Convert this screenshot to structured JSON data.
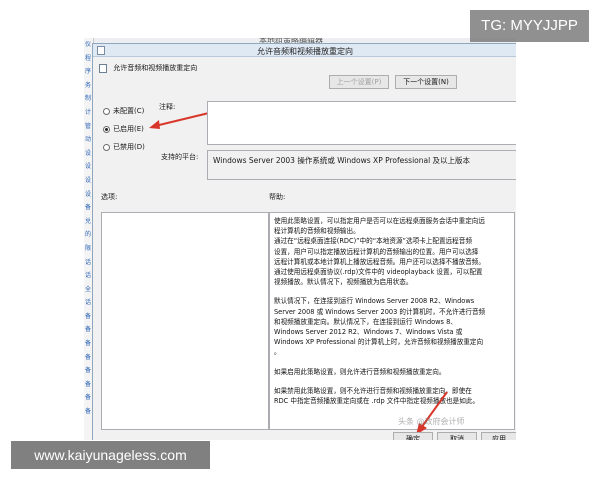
{
  "background_window": {
    "title": "本地组策略编辑器",
    "left_strip": [
      "仪",
      "程",
      "序",
      "务",
      "制",
      "计",
      "管",
      "动",
      "设",
      "设",
      "设",
      "设",
      "备",
      "兑",
      "的",
      "限",
      "话",
      "话",
      "全",
      "话",
      "备",
      "备",
      "备",
      "备",
      "备",
      "备",
      "备",
      "备"
    ]
  },
  "dialog": {
    "title": "允许音频和视频播放重定向",
    "policy_name": "允许音频和视频播放重定向",
    "prev_button": "上一个设置(P)",
    "next_button": "下一个设置(N)",
    "radios": [
      {
        "label": "未配置(C)",
        "checked": false
      },
      {
        "label": "已启用(E)",
        "checked": true
      },
      {
        "label": "已禁用(D)",
        "checked": false
      }
    ],
    "comment_label": "注释:",
    "platform_label": "支持的平台:",
    "platform_value": "Windows Server 2003 操作系统或 Windows XP Professional 及以上版本",
    "options_label": "选项:",
    "help_label": "帮助:",
    "help_paragraphs": [
      "使用此策略设置，可以指定用户是否可以在远程桌面服务会话中重定向远\n程计算机的音频和视频输出。\n通过在“远程桌面连接(RDC)”中的“本地资源”选项卡上配置远程音频\n设置，用户可以指定播放远程计算机的音频输出的位置。用户可以选择\n远程计算机或本地计算机上播放远程音频。用户还可以选择不播放音频。\n通过使用远程桌面协议(.rdp)文件中的 videoplayback 设置，可以配置\n视频播放。默认情况下，视频播放为启用状态。",
      "默认情况下，在连接到运行 Windows Server 2008 R2、Windows\nServer 2008 或 Windows Server 2003 的计算机时，不允许进行音频\n和视频播放重定向。默认情况下，在连接到运行 Windows 8、\nWindows Server 2012 R2、Windows 7、Windows Vista 或\nWindows XP Professional 的计算机上时，允许音频和视频播放重定向\n。",
      "如果启用此策略设置，则允许进行音频和视频播放重定向。",
      "如果禁用此策略设置，则不允许进行音频和视频播放重定向，即使在\nRDC 中指定音频播放重定向或在 .rdp 文件中指定视频播放也是如此。"
    ],
    "ok_button": "确定",
    "cancel_button": "取消",
    "apply_button": "应用"
  },
  "overlays": {
    "watermark": "TG: MYYJJPP",
    "url_banner": "www.kaiyunageless.com",
    "faint_text": "头条 @政府会计师"
  },
  "colors": {
    "annotation_arrow": "#d9362b",
    "titlebar": "#dfe9f4",
    "dialog_bg": "#f1f1f1"
  }
}
